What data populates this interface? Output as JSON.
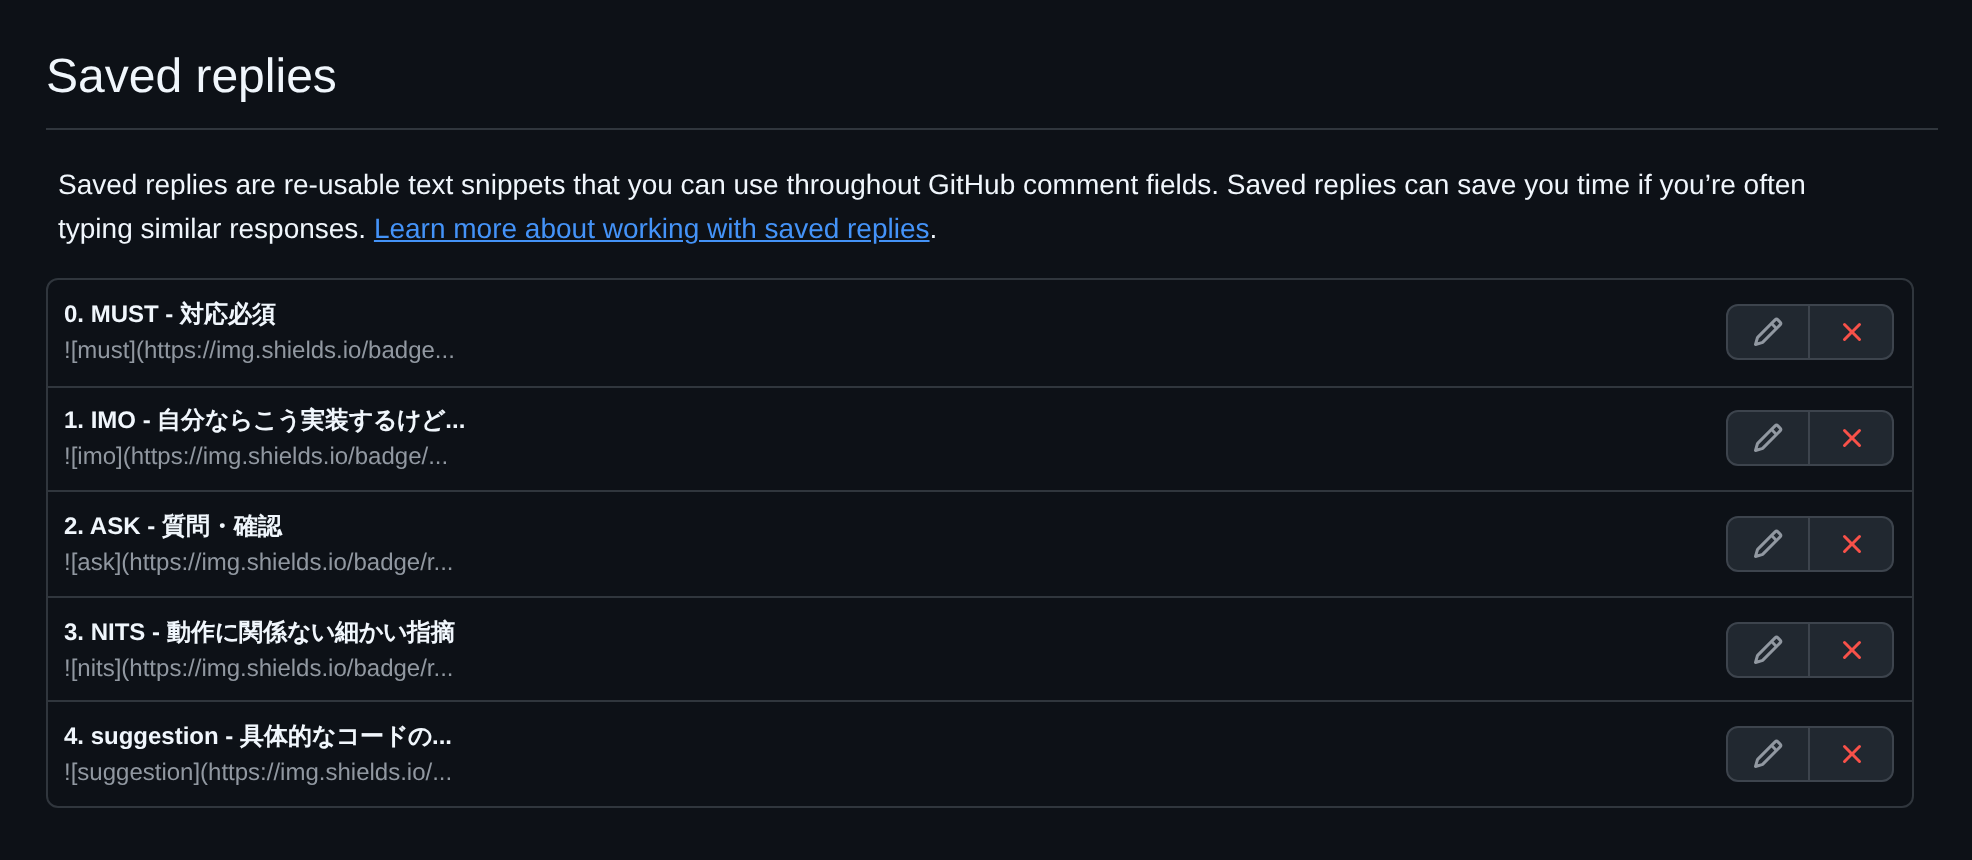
{
  "title": "Saved replies",
  "description": {
    "text": "Saved replies are re-usable text snippets that you can use throughout GitHub comment fields. Saved replies can save you time if you’re often typing similar responses. ",
    "link": "Learn more about working with saved replies",
    "after": "."
  },
  "replies": [
    {
      "title": "0. MUST - 対応必須",
      "body": "![must](https://img.shields.io/badge..."
    },
    {
      "title": "1. IMO - 自分ならこう実装するけど...",
      "body": "![imo](https://img.shields.io/badge/..."
    },
    {
      "title": "2. ASK - 質問・確認",
      "body": "![ask](https://img.shields.io/badge/r..."
    },
    {
      "title": "3. NITS - 動作に関係ない細かい指摘",
      "body": "![nits](https://img.shields.io/badge/r..."
    },
    {
      "title": "4. suggestion - 具体的なコードの...",
      "body": "![suggestion](https://img.shields.io/..."
    }
  ]
}
